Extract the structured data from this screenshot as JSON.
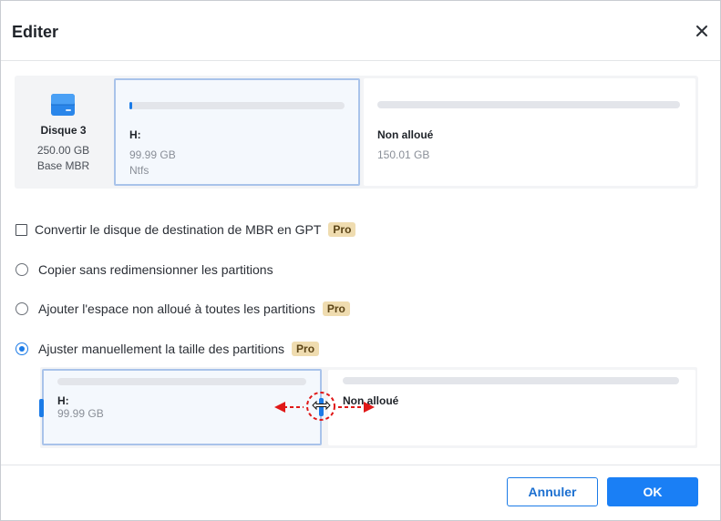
{
  "dialog": {
    "title": "Editer"
  },
  "disk": {
    "name": "Disque 3",
    "size": "250.00 GB",
    "type": "Base MBR",
    "partitions": [
      {
        "label": "H:",
        "size": "99.99 GB",
        "fs": "Ntfs",
        "used_fraction": 0.01
      },
      {
        "label": "Non alloué",
        "size": "150.01 GB"
      }
    ]
  },
  "options": [
    {
      "kind": "checkbox",
      "label": "Convertir le disque de destination de MBR en GPT",
      "pro": "Pro",
      "checked": false
    },
    {
      "kind": "radio",
      "label": "Copier sans redimensionner les partitions",
      "checked": false
    },
    {
      "kind": "radio",
      "label": "Ajouter l'espace non alloué à toutes les partitions",
      "pro": "Pro",
      "checked": false
    },
    {
      "kind": "radio",
      "label": "Ajuster manuellement la taille des partitions",
      "pro": "Pro",
      "checked": true
    }
  ],
  "resize": {
    "left": {
      "label": "H:",
      "size": "99.99 GB"
    },
    "right": {
      "label": "Non alloué"
    }
  },
  "footer": {
    "cancel_label": "Annuler",
    "ok_label": "OK"
  },
  "colors": {
    "accent": "#1a7ff5",
    "pro_badge": "#efdcb0",
    "annotation": "#e01818"
  }
}
